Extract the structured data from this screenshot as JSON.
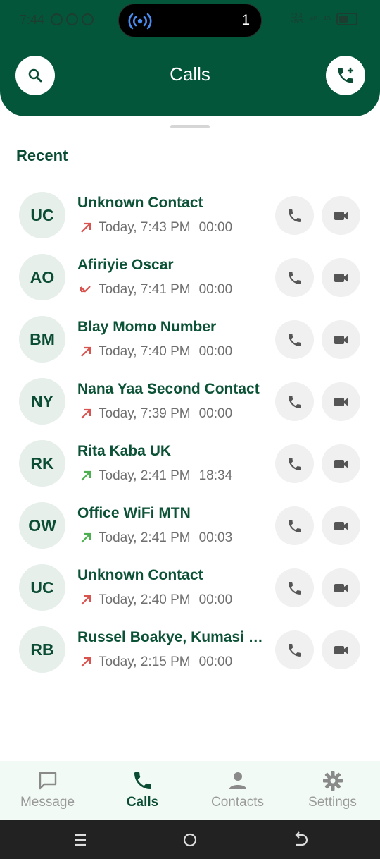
{
  "status_bar": {
    "time": "7:44",
    "island_count": "1",
    "net_speed_value": "12.4",
    "net_speed_unit": "KB/S",
    "signal_1": "4G",
    "signal_2": "4G",
    "battery_level": "40"
  },
  "header": {
    "title": "Calls",
    "search_icon": "search-icon",
    "add_call_icon": "add-call-icon",
    "colors": {
      "primary": "#04563a",
      "text": "#0b4d34"
    }
  },
  "section": {
    "title": "Recent"
  },
  "calls": [
    {
      "initials": "UC",
      "name": "Unknown Contact",
      "direction": "outgoing-missed",
      "time": "Today, 7:43 PM",
      "duration": "00:00"
    },
    {
      "initials": "AO",
      "name": "Afiriyie Oscar",
      "direction": "missed",
      "time": "Today, 7:41 PM",
      "duration": "00:00"
    },
    {
      "initials": "BM",
      "name": "Blay Momo Number",
      "direction": "outgoing-missed",
      "time": "Today, 7:40 PM",
      "duration": "00:00"
    },
    {
      "initials": "NY",
      "name": "Nana Yaa Second Contact",
      "direction": "outgoing-missed",
      "time": "Today, 7:39 PM",
      "duration": "00:00"
    },
    {
      "initials": "RK",
      "name": "Rita Kaba UK",
      "direction": "outgoing",
      "time": "Today, 2:41 PM",
      "duration": "18:34"
    },
    {
      "initials": "OW",
      "name": "Office WiFi MTN",
      "direction": "outgoing",
      "time": "Today, 2:41 PM",
      "duration": "00:03"
    },
    {
      "initials": "UC",
      "name": "Unknown Contact",
      "direction": "outgoing-missed",
      "time": "Today, 2:40 PM",
      "duration": "00:00"
    },
    {
      "initials": "RB",
      "name": "Russel Boakye, Kumasi D...",
      "direction": "outgoing-missed",
      "time": "Today, 2:15 PM",
      "duration": "00:00"
    }
  ],
  "bottom_nav": [
    {
      "label": "Message",
      "icon": "message-icon",
      "active": false
    },
    {
      "label": "Calls",
      "icon": "phone-icon",
      "active": true
    },
    {
      "label": "Contacts",
      "icon": "person-icon",
      "active": false
    },
    {
      "label": "Settings",
      "icon": "gear-icon",
      "active": false
    }
  ]
}
